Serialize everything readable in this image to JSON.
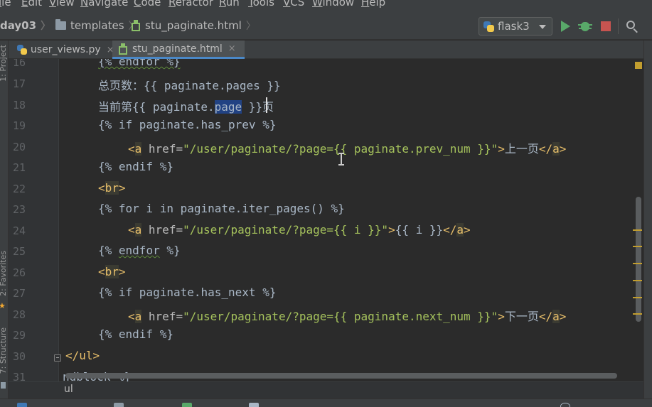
{
  "menu": [
    "ile",
    "Edit",
    "View",
    "Navigate",
    "Code",
    "Refactor",
    "Run",
    "Tools",
    "VCS",
    "Window",
    "Help"
  ],
  "breadcrumb": {
    "project": "day03",
    "folder": "templates",
    "file": "stu_paginate.html"
  },
  "run_config": {
    "name": "flask3",
    "icon": "python-icon"
  },
  "toolbar_icons": [
    "run-icon",
    "debug-icon",
    "stop-icon",
    "search-icon"
  ],
  "tool_strip": {
    "project": "1: Project",
    "favorites": "2: Favorites",
    "structure": "7: Structure"
  },
  "tabs": [
    {
      "label": "user_views.py",
      "icon": "python-icon",
      "active": false
    },
    {
      "label": "stu_paginate.html",
      "icon": "html-icon",
      "active": true
    }
  ],
  "editor": {
    "line_numbers": [
      "16",
      "17",
      "18",
      "19",
      "20",
      "21",
      "22",
      "23",
      "24",
      "25",
      "26",
      "27",
      "28",
      "29",
      "30",
      "31"
    ],
    "lines": {
      "l16": "{% endfor %}",
      "l17": "总页数：{{ paginate.pages }}",
      "l18_a": "当前第{{ paginate.",
      "l18_sel": "page",
      "l18_b": " }}页",
      "l19": "{% if paginate.has_prev %}",
      "l20_lt": "<",
      "l20_tag": "a",
      "l20_attr": " href=",
      "l20_str": "\"/user/paginate/?page={{ paginate.prev_num }}\"",
      "l20_gt": ">",
      "l20_text": "上一页",
      "l20_close_lt": "</",
      "l20_close_tag": "a",
      "l20_close_gt": ">",
      "l21": "{% endif %}",
      "l22_lt": "<",
      "l22_tag": "br",
      "l22_gt": ">",
      "l23": "{% for i in paginate.iter_pages() %}",
      "l24_lt": "<",
      "l24_tag": "a",
      "l24_attr": " href=",
      "l24_str": "\"/user/paginate/?page={{ i }}\"",
      "l24_gt": ">",
      "l24_text": "{{ i }}",
      "l24_close_lt": "</",
      "l24_close_tag": "a",
      "l24_close_gt": ">",
      "l25_a": "{% ",
      "l25_kw": "endfor",
      "l25_b": " %}",
      "l26_lt": "<",
      "l26_tag": "br",
      "l26_gt": ">",
      "l27": "{% if paginate.has_next %}",
      "l28_lt": "<",
      "l28_tag": "a",
      "l28_attr": " href=",
      "l28_str": "\"/user/paginate/?page={{ paginate.next_num }}\"",
      "l28_gt": ">",
      "l28_text": "下一页",
      "l28_close_lt": "</",
      "l28_close_tag": "a",
      "l28_close_gt": ">",
      "l29": "{% endif %}",
      "l30": "</ul>",
      "l31": "ndblock %}"
    }
  },
  "code_breadcrumb": "ul",
  "colors": {
    "background": "#2b2b2b",
    "gutter": "#313335",
    "chrome": "#3c3f41",
    "tag": "#e8bf6a",
    "string": "#a5c25c",
    "default_text": "#a9b7c6",
    "selection": "#214283",
    "active_tab_underline": "#4a88c7",
    "run_green": "#59a869",
    "stop_red": "#c75450"
  }
}
